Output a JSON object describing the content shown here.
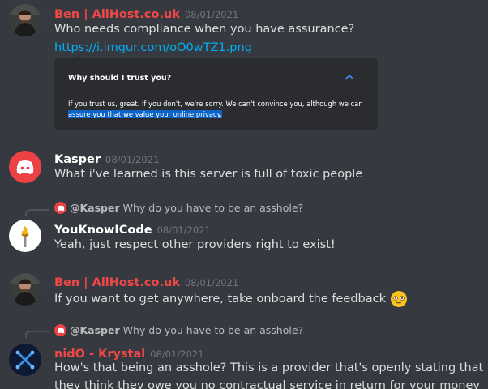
{
  "messages": [
    {
      "author": "Ben | AllHost.co.uk",
      "author_color": "#f04747",
      "timestamp": "08/01/2021",
      "lines": [
        "Who needs compliance when you have assurance?"
      ],
      "link": "https://i.imgur.com/oO0wTZ1.png",
      "embed": {
        "title": "Why should I trust you?",
        "body_plain": "If you trust us, great. If you don't, we're sorry. We can't convince you, although we can",
        "body_highlighted": "assure you that we value your online privacy."
      }
    },
    {
      "author": "Kasper",
      "author_color": "#ffffff",
      "timestamp": "08/01/2021",
      "lines": [
        "What i've learned is this server is full of toxic people"
      ]
    },
    {
      "reply_to": "@Kasper",
      "reply_text": "Why do you have to be an asshole?",
      "author": "YouKnowICode",
      "author_color": "#ffffff",
      "timestamp": "08/01/2021",
      "lines": [
        "Yeah, just respect other providers right to exist!"
      ]
    },
    {
      "author": "Ben | AllHost.co.uk",
      "author_color": "#f04747",
      "timestamp": "08/01/2021",
      "lines": [
        "If you want to get anywhere, take onboard the feedback"
      ]
    },
    {
      "reply_to": "@Kasper",
      "reply_text": "Why do you have to be an asshole?",
      "author": "nidO - Krystal",
      "author_color": "#f04747",
      "timestamp": "08/01/2021",
      "lines": [
        "How's that being an asshole? This is a provider that's openly stating that",
        "they think they owe you no contractual service in return for your money"
      ]
    }
  ],
  "colors": {
    "background": "#36393f",
    "link": "#00b0f4",
    "discord_red": "#ed4245",
    "highlight": "#0a64c8"
  },
  "icons": [
    "discord-logo-icon",
    "torch-icon",
    "flushed-face-emoji-icon",
    "chevron-up-icon",
    "krystal-logo-icon"
  ]
}
